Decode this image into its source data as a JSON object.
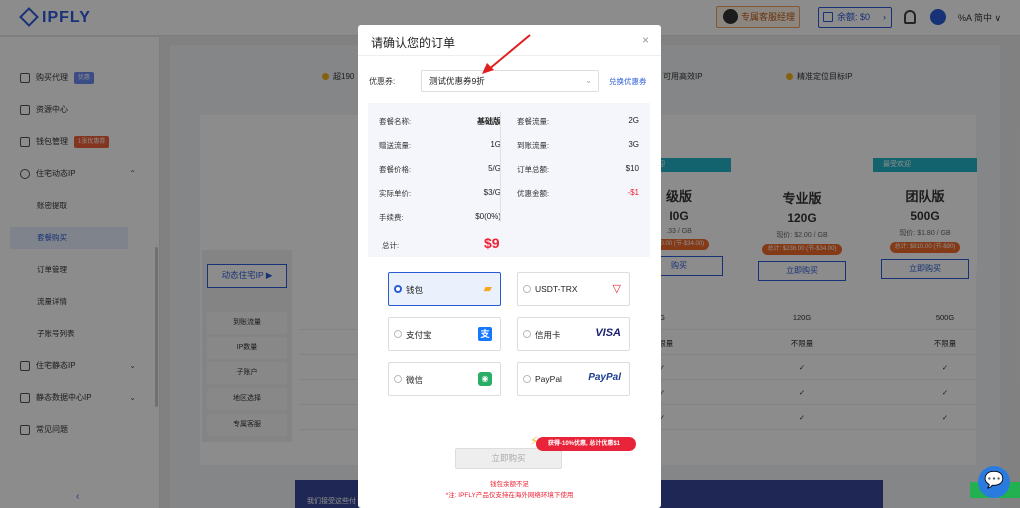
{
  "header": {
    "logo": "IPFLY",
    "support_btn": "专属客服经理",
    "balance": "余额:  $0",
    "lang": "简中"
  },
  "sidebar": {
    "items": [
      {
        "label": "购买代理",
        "tag": "优惠"
      },
      {
        "label": "资源中心"
      },
      {
        "label": "钱包管理",
        "tag": "1张优惠券"
      },
      {
        "label": "住宅动态IP"
      },
      {
        "label": "账密提取"
      },
      {
        "label": "套餐购买"
      },
      {
        "label": "订单管理"
      },
      {
        "label": "流量详情"
      },
      {
        "label": "子账号列表"
      },
      {
        "label": "住宅静态IP"
      },
      {
        "label": "静态数据中心IP"
      },
      {
        "label": "常见问题"
      }
    ]
  },
  "background": {
    "features": [
      "超190",
      "可用高效IP",
      "精准定位目标IP"
    ],
    "left_nav_button": "动态住宅IP ▶",
    "left_nav_cells": [
      "到账流量",
      "IP数量",
      "子账户",
      "地区选择",
      "专属客服"
    ],
    "cards": [
      {
        "badge": "最受欢迎",
        "name": "级版",
        "gb": "I0G",
        "price": ".33 / GB",
        "total": "400.00 (节-$34.00)",
        "buy": "购买"
      },
      {
        "name": "专业版",
        "gb": "120G",
        "price": "现价: $2.00 / GB",
        "total": "总计: $236.00 (节-$34.00)",
        "buy": "立即购买"
      },
      {
        "badge": "最受欢迎",
        "name": "团队版",
        "gb": "500G",
        "price": "现价: $1.80 / GB",
        "total": "总计: $810.00 (节-$90)",
        "buy": "立即购买"
      }
    ],
    "grid": {
      "r1": [
        "G",
        "120G",
        "500G"
      ],
      "r2": [
        "不限量",
        "不限量",
        "不限量"
      ],
      "check": "✓"
    },
    "banner": "我们接受这些付"
  },
  "modal": {
    "title": "请确认您的订单",
    "close": "×",
    "coupon_label": "优惠券:",
    "coupon_value": "测试优惠券9折",
    "coupon_link": "兑换优惠券",
    "left": [
      {
        "k": "套餐名称:",
        "v": "基础版"
      },
      {
        "k": "赠送流量:",
        "v": "1G"
      },
      {
        "k": "套餐价格:",
        "v": "5/G"
      },
      {
        "k": "实际单价:",
        "v": "$3/G"
      },
      {
        "k": "手续费:",
        "v": "$0(0%)"
      }
    ],
    "right": [
      {
        "k": "套餐流量:",
        "v": "2G"
      },
      {
        "k": "到账流量:",
        "v": "3G"
      },
      {
        "k": "订单总额:",
        "v": "$10"
      },
      {
        "k": "优惠金额:",
        "v": "-$1"
      }
    ],
    "total_label": "总计:",
    "total_value": "$9",
    "payments": [
      {
        "label": "钱包",
        "logo": "wallet-icon"
      },
      {
        "label": "USDT-TRX",
        "logo": "tron-icon"
      },
      {
        "label": "支付宝",
        "logo": "alipay-icon"
      },
      {
        "label": "信用卡",
        "logo": "VISA"
      },
      {
        "label": "微信",
        "logo": "wechat-icon"
      },
      {
        "label": "PayPal",
        "logo": "PayPal"
      }
    ],
    "promo": "获得-10%优惠, 总计优惠$1",
    "buy_button": "立即购买",
    "warn1": "钱包余额不足",
    "warn2": "*注: IPFLY产品仅支持在海外网络环境下使用"
  },
  "colors": {
    "accent": "#2a5bd7",
    "danger": "#e2233b",
    "promo": "#e8233a"
  }
}
